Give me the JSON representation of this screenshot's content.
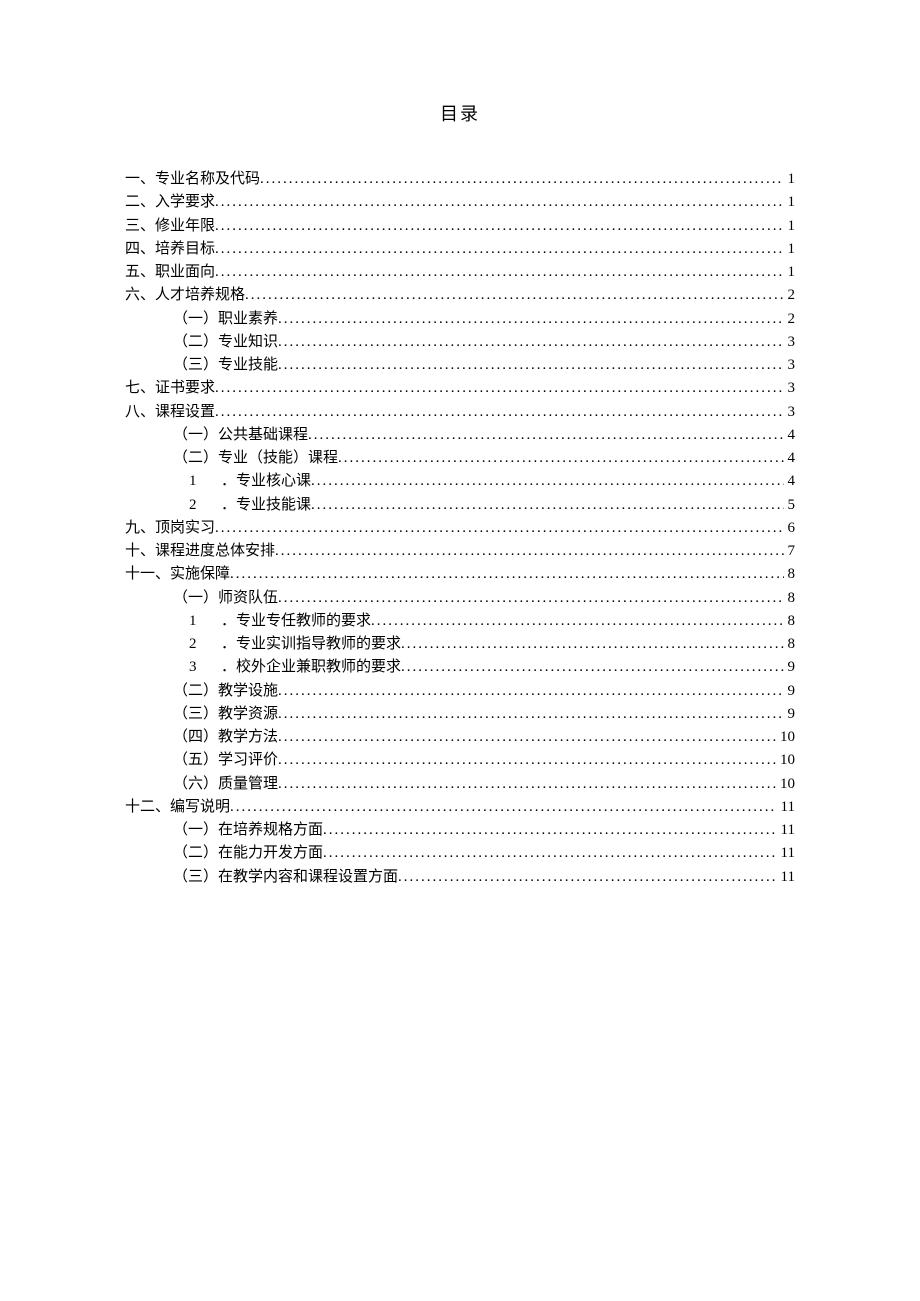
{
  "title": "目录",
  "entries": [
    {
      "indent": 0,
      "label": "一、专业名称及代码",
      "page": "1"
    },
    {
      "indent": 0,
      "label": "二、入学要求",
      "page": "1"
    },
    {
      "indent": 0,
      "label": "三、修业年限",
      "page": "1"
    },
    {
      "indent": 0,
      "label": "四、培养目标",
      "page": "1"
    },
    {
      "indent": 0,
      "label": "五、职业面向",
      "page": "1"
    },
    {
      "indent": 0,
      "label": "六、人才培养规格",
      "page": "2"
    },
    {
      "indent": 1,
      "label": "（一）职业素养",
      "page": "2"
    },
    {
      "indent": 1,
      "label": "（二）专业知识",
      "page": "3"
    },
    {
      "indent": 1,
      "label": "（三）专业技能",
      "page": "3"
    },
    {
      "indent": 0,
      "label": "七、证书要求",
      "page": "3"
    },
    {
      "indent": 0,
      "label": "八、课程设置",
      "page": "3"
    },
    {
      "indent": 1,
      "label": "（一）公共基础课程",
      "page": "4"
    },
    {
      "indent": 1,
      "label": "（二）专业（技能）课程",
      "page": "4"
    },
    {
      "indent": 2,
      "num": "1",
      "label": "．专业核心课",
      "page": "4"
    },
    {
      "indent": 2,
      "num": "2",
      "label": "．专业技能课",
      "page": "5"
    },
    {
      "indent": 0,
      "label": "九、顶岗实习",
      "page": "6"
    },
    {
      "indent": 0,
      "label": "十、课程进度总体安排",
      "page": "7"
    },
    {
      "indent": 0,
      "label": "十一、实施保障",
      "page": "8"
    },
    {
      "indent": 1,
      "label": "（一）师资队伍",
      "page": "8"
    },
    {
      "indent": 2,
      "num": "1",
      "label": "．专业专任教师的要求",
      "page": "8"
    },
    {
      "indent": 2,
      "num": "2",
      "label": "．专业实训指导教师的要求",
      "page": "8"
    },
    {
      "indent": 2,
      "num": "3",
      "label": "．校外企业兼职教师的要求",
      "page": "9"
    },
    {
      "indent": 1,
      "label": "（二）教学设施",
      "page": "9"
    },
    {
      "indent": 1,
      "label": "（三）教学资源",
      "page": "9"
    },
    {
      "indent": 1,
      "label": "（四）教学方法",
      "page": "10"
    },
    {
      "indent": 1,
      "label": "（五）学习评价",
      "page": "10"
    },
    {
      "indent": 1,
      "label": "（六）质量管理",
      "page": "10"
    },
    {
      "indent": 0,
      "label": "十二、编写说明",
      "page": "11"
    },
    {
      "indent": 1,
      "label": "（一）在培养规格方面",
      "page": "11"
    },
    {
      "indent": 1,
      "label": "（二）在能力开发方面",
      "page": "11"
    },
    {
      "indent": 1,
      "label": "（三）在教学内容和课程设置方面",
      "page": "11"
    }
  ]
}
